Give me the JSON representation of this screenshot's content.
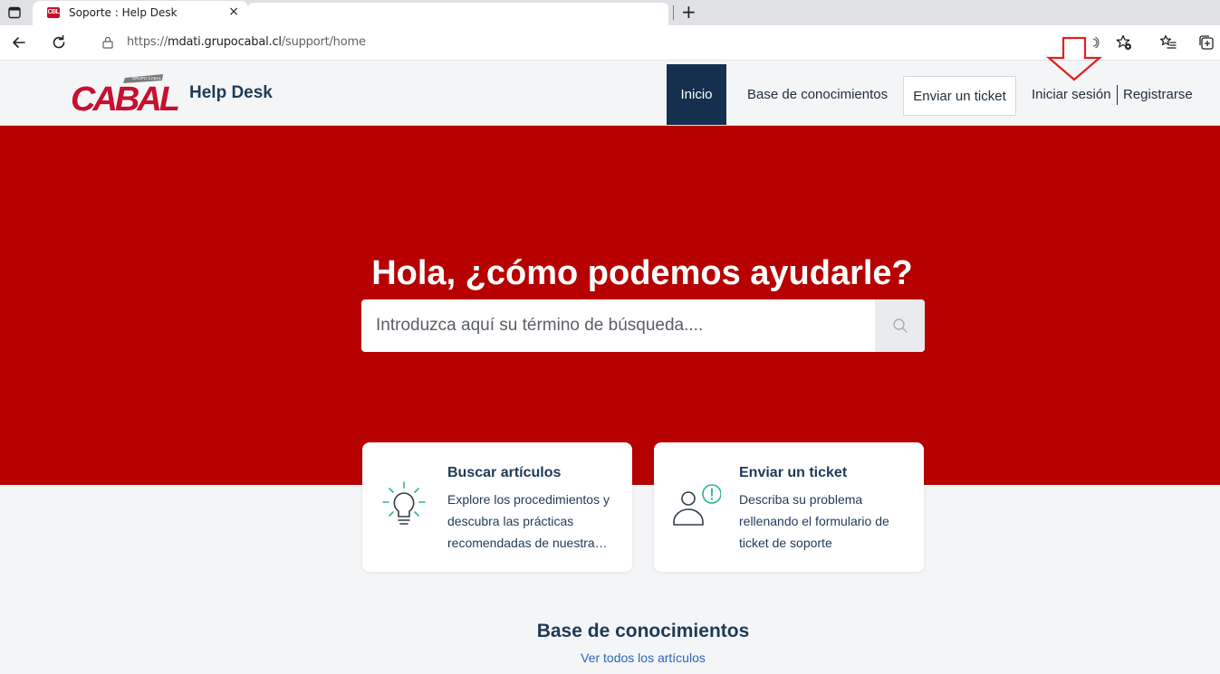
{
  "browser": {
    "tab_title": "Soporte : Help Desk",
    "tab_favicon_text": "CBL",
    "close_glyph": "×",
    "new_tab_glyph": "+",
    "url_prefix": "https://",
    "url_domain": "mdati.grupocabal.cl",
    "url_path": "/support/home"
  },
  "header": {
    "logo_text": "CABAL",
    "logo_sub": "GRUPO CABAL",
    "brand": "Help Desk",
    "nav": {
      "home": "Inicio",
      "knowledge_base": "Base de conocimientos",
      "submit_ticket": "Enviar un ticket",
      "login": "Iniciar sesión",
      "register": "Registrarse"
    }
  },
  "hero": {
    "title": "Hola, ¿cómo podemos ayudarle?",
    "search_placeholder": "Introduzca aquí su término de búsqueda...."
  },
  "cards": [
    {
      "title": "Buscar artículos",
      "description": "Explore los procedimientos y descubra las prácticas recomendadas de nuestra base de conocimientos",
      "icon": "lightbulb-icon"
    },
    {
      "title": "Enviar un ticket",
      "description": "Describa su problema rellenando el formulario de ticket de soporte",
      "icon": "user-alert-icon"
    }
  ],
  "knowledge_base": {
    "title": "Base de conocimientos",
    "view_all": "Ver todos los artículos"
  },
  "colors": {
    "hero_red": "#b70000",
    "nav_active": "#14304e",
    "accent_green": "#2bb68f",
    "annotation_red": "#e02020"
  }
}
